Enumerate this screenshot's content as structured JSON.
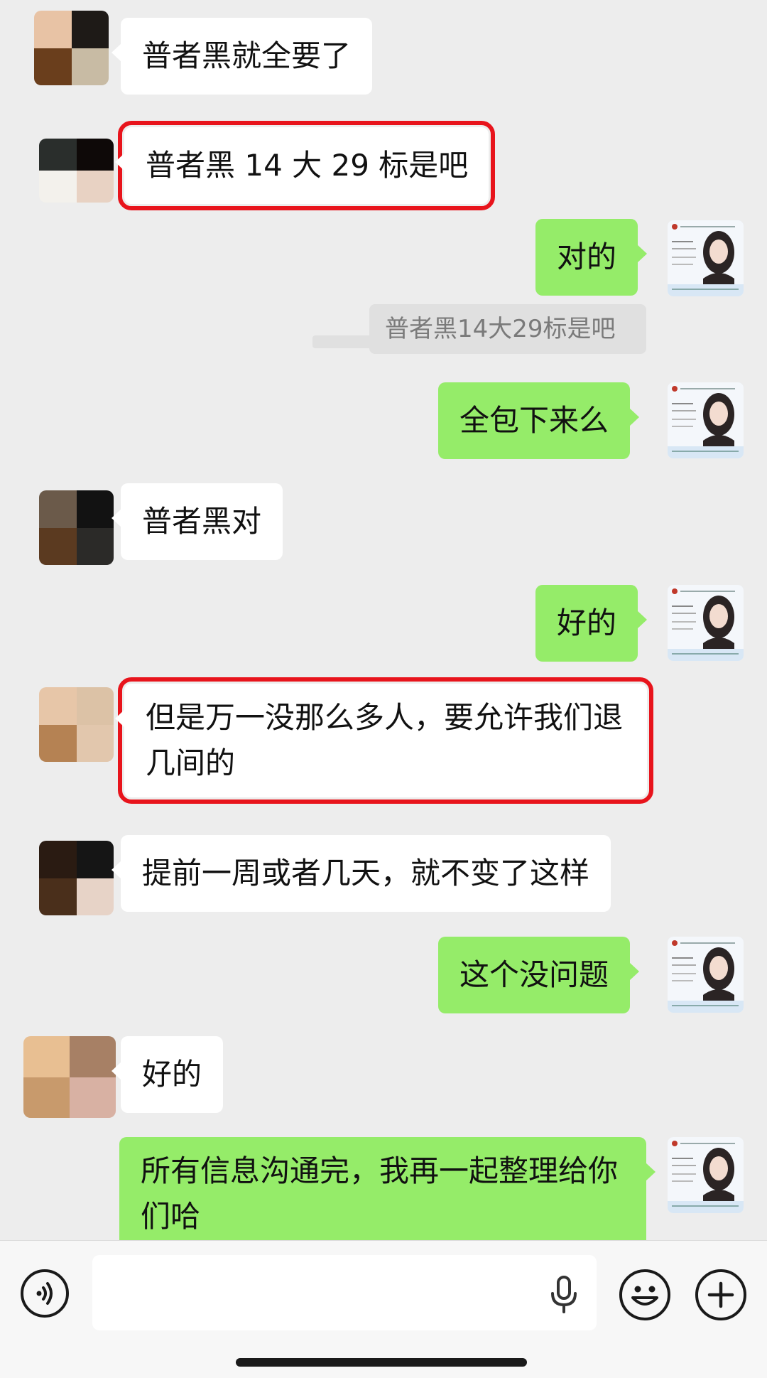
{
  "messages": [
    {
      "side": "in",
      "text": "普者黑就全要了"
    },
    {
      "side": "in",
      "text": "普者黑 14 大 29 标是吧",
      "highlighted": true
    },
    {
      "side": "out",
      "text": "对的"
    },
    {
      "side": "out",
      "type": "quote",
      "text": "普者黑14大29标是吧"
    },
    {
      "side": "out",
      "text": "全包下来么"
    },
    {
      "side": "in",
      "text": "普者黑对"
    },
    {
      "side": "out",
      "text": "好的"
    },
    {
      "side": "in",
      "text": "但是万一没那么多人，要允许我们退几间的",
      "highlighted": true
    },
    {
      "side": "in",
      "text": "提前一周或者几天，就不变了这样"
    },
    {
      "side": "out",
      "text": "这个没问题"
    },
    {
      "side": "in",
      "text": "好的"
    },
    {
      "side": "out",
      "text": "所有信息沟通完，我再一起整理给你们哈"
    }
  ],
  "input_bar": {
    "placeholder": "",
    "icons": [
      "voice-mode-icon",
      "microphone-icon",
      "emoji-icon",
      "plus-icon"
    ]
  },
  "colors": {
    "background": "#ededed",
    "incoming_bubble": "#ffffff",
    "outgoing_bubble": "#95ec69",
    "highlight_box": "#e8141c",
    "quote_background": "#e0e0e0"
  }
}
